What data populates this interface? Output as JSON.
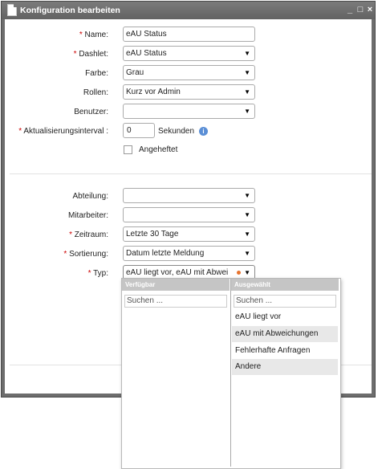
{
  "window": {
    "title": "Konfiguration bearbeiten",
    "controls": [
      "_",
      "□",
      "×"
    ]
  },
  "form": {
    "name": {
      "label": "Name:",
      "required": true,
      "value": "eAU Status"
    },
    "dashlet": {
      "label": "Dashlet:",
      "required": true,
      "value": "eAU Status"
    },
    "farbe": {
      "label": "Farbe:",
      "required": false,
      "value": "Grau"
    },
    "rollen": {
      "label": "Rollen:",
      "required": false,
      "value": "Kurz vor Admin"
    },
    "benutzer": {
      "label": "Benutzer:",
      "required": false,
      "value": ""
    },
    "interval": {
      "label": "Aktualisierungsinterval :",
      "required": true,
      "value": "0",
      "unit": "Sekunden"
    },
    "angeheftet": {
      "label": "Angeheftet",
      "checked": false
    },
    "abteilung": {
      "label": "Abteilung:",
      "required": false,
      "value": ""
    },
    "mitarbeiter": {
      "label": "Mitarbeiter:",
      "required": false,
      "value": ""
    },
    "zeitraum": {
      "label": "Zeitraum:",
      "required": true,
      "value": "Letzte 30 Tage"
    },
    "sortierung": {
      "label": "Sortierung:",
      "required": true,
      "value": "Datum letzte Meldung"
    },
    "typ": {
      "label": "Typ:",
      "required": true,
      "value": "eAU liegt vor, eAU mit Abwei"
    }
  },
  "typ_dropdown": {
    "available": {
      "header": "Verfügbar",
      "search_placeholder": "Suchen ...",
      "items": []
    },
    "selected": {
      "header": "Ausgewählt",
      "search_placeholder": "Suchen ...",
      "items": [
        "eAU liegt vor",
        "eAU mit Abweichungen",
        "Fehlerhafte Anfragen",
        "Andere"
      ]
    }
  },
  "colors": {
    "titlebar": "#6d6d6d",
    "required": "#cc0000",
    "info": "#5b8fd6",
    "modified_dot": "#e8742e"
  }
}
